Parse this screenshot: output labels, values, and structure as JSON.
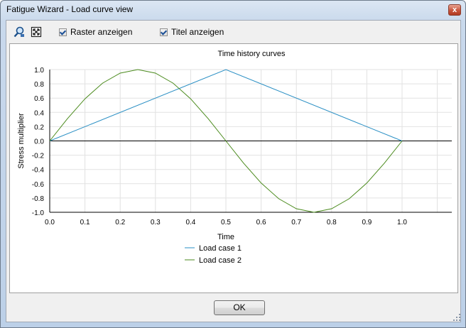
{
  "window": {
    "title": "Fatigue Wizard - Load curve view",
    "close_label": "x"
  },
  "toolbar": {
    "icons": [
      "zoom-icon",
      "fit-view-icon"
    ],
    "raster_label": "Raster anzeigen",
    "raster_checked": true,
    "title_label": "Titel anzeigen",
    "title_checked": true
  },
  "chart_data": {
    "type": "line",
    "title": "Time history curves",
    "xlabel": "Time",
    "ylabel": "Stress multiplier",
    "xlim": [
      0.0,
      1.0
    ],
    "ylim": [
      -1.0,
      1.0
    ],
    "x_ticks": [
      "0.0",
      "0.1",
      "0.2",
      "0.3",
      "0.4",
      "0.5",
      "0.6",
      "0.7",
      "0.8",
      "0.9",
      "1.0"
    ],
    "y_ticks": [
      "1.0",
      "0.8",
      "0.6",
      "0.4",
      "0.2",
      "0.0",
      "-0.2",
      "-0.4",
      "-0.6",
      "-0.8",
      "-1.0"
    ],
    "grid": true,
    "legend_position": "bottom",
    "series": [
      {
        "name": "Load case 1",
        "color": "#2a8fc4",
        "x": [
          0.0,
          0.5,
          1.0
        ],
        "y": [
          0.0,
          1.0,
          0.0
        ]
      },
      {
        "name": "Load case 2",
        "color": "#4a8a1c",
        "x": [
          0.0,
          0.05,
          0.1,
          0.15,
          0.2,
          0.25,
          0.3,
          0.35,
          0.4,
          0.45,
          0.5,
          0.55,
          0.6,
          0.65,
          0.7,
          0.75,
          0.8,
          0.85,
          0.9,
          0.95,
          1.0
        ],
        "y": [
          0.0,
          0.31,
          0.59,
          0.81,
          0.95,
          1.0,
          0.95,
          0.81,
          0.59,
          0.31,
          0.0,
          -0.31,
          -0.59,
          -0.81,
          -0.95,
          -1.0,
          -0.95,
          -0.81,
          -0.59,
          -0.31,
          0.0
        ]
      }
    ]
  },
  "buttons": {
    "ok_label": "OK"
  }
}
